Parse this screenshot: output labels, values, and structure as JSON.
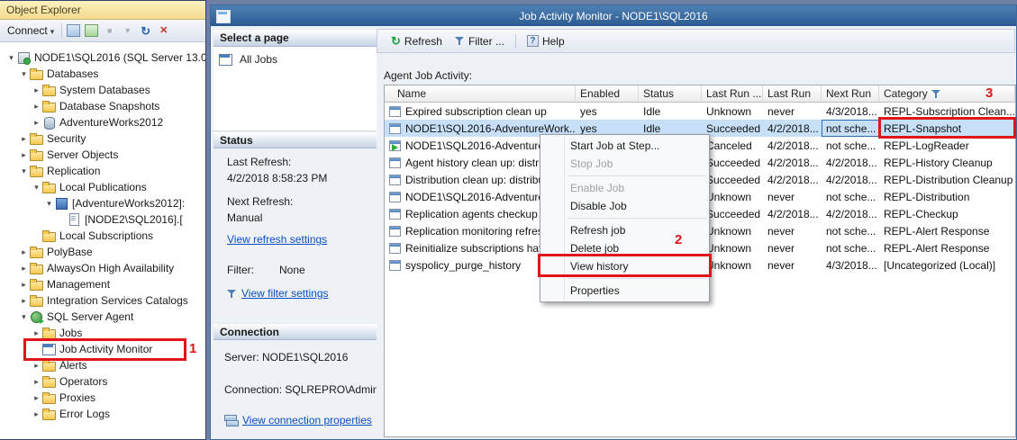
{
  "annotations": {
    "one": "1",
    "two": "2",
    "three": "3"
  },
  "object_explorer": {
    "title": "Object Explorer",
    "toolbar": {
      "connect_label": "Connect"
    },
    "tree": [
      {
        "label": "NODE1\\SQL2016 (SQL Server 13.0.",
        "level": 0,
        "exp": "-",
        "icon": "server"
      },
      {
        "label": "Databases",
        "level": 1,
        "exp": "-",
        "icon": "folder"
      },
      {
        "label": "System Databases",
        "level": 2,
        "exp": "+",
        "icon": "folder"
      },
      {
        "label": "Database Snapshots",
        "level": 2,
        "exp": "+",
        "icon": "folder"
      },
      {
        "label": "AdventureWorks2012",
        "level": 2,
        "exp": "+",
        "icon": "db"
      },
      {
        "label": "Security",
        "level": 1,
        "exp": "+",
        "icon": "folder"
      },
      {
        "label": "Server Objects",
        "level": 1,
        "exp": "+",
        "icon": "folder"
      },
      {
        "label": "Replication",
        "level": 1,
        "exp": "-",
        "icon": "folder"
      },
      {
        "label": "Local Publications",
        "level": 2,
        "exp": "-",
        "icon": "folder"
      },
      {
        "label": "[AdventureWorks2012]:",
        "level": 3,
        "exp": "-",
        "icon": "pub"
      },
      {
        "label": "[NODE2\\SQL2016].[",
        "level": 4,
        "exp": "",
        "icon": "sub"
      },
      {
        "label": "Local Subscriptions",
        "level": 2,
        "exp": "",
        "icon": "folder"
      },
      {
        "label": "PolyBase",
        "level": 1,
        "exp": "+",
        "icon": "folder"
      },
      {
        "label": "AlwaysOn High Availability",
        "level": 1,
        "exp": "+",
        "icon": "folder"
      },
      {
        "label": "Management",
        "level": 1,
        "exp": "+",
        "icon": "folder"
      },
      {
        "label": "Integration Services Catalogs",
        "level": 1,
        "exp": "+",
        "icon": "folder"
      },
      {
        "label": "SQL Server Agent",
        "level": 1,
        "exp": "-",
        "icon": "agent"
      },
      {
        "label": "Jobs",
        "level": 2,
        "exp": "+",
        "icon": "folder"
      },
      {
        "label": "Job Activity Monitor",
        "level": 2,
        "exp": "",
        "icon": "jam"
      },
      {
        "label": "Alerts",
        "level": 2,
        "exp": "+",
        "icon": "folder"
      },
      {
        "label": "Operators",
        "level": 2,
        "exp": "+",
        "icon": "folder"
      },
      {
        "label": "Proxies",
        "level": 2,
        "exp": "+",
        "icon": "folder"
      },
      {
        "label": "Error Logs",
        "level": 2,
        "exp": "+",
        "icon": "folder"
      }
    ]
  },
  "jam": {
    "title": "Job Activity Monitor - NODE1\\SQL2016",
    "select_page": {
      "header": "Select a page",
      "items": [
        {
          "label": "All Jobs"
        }
      ]
    },
    "status": {
      "header": "Status",
      "last_refresh_label": "Last Refresh:",
      "last_refresh_value": "4/2/2018 8:58:23 PM",
      "next_refresh_label": "Next Refresh:",
      "next_refresh_value": "Manual",
      "refresh_link": "View refresh settings",
      "filter_label": "Filter:",
      "filter_value": "None",
      "filter_link": "View filter settings"
    },
    "connection": {
      "header": "Connection",
      "server_text": "Server: NODE1\\SQL2016",
      "connection_text": "Connection: SQLREPRO\\Administra",
      "link": "View connection properties"
    },
    "toolbar": {
      "refresh": "Refresh",
      "filter": "Filter ...",
      "help": "Help"
    },
    "grid_caption": "Agent Job Activity:",
    "grid": {
      "columns": [
        "Name",
        "Enabled",
        "Status",
        "Last Run ...",
        "Last Run",
        "Next Run",
        "Category"
      ],
      "filtered_column": "Category",
      "selected_row": 1,
      "running_row": 2,
      "focus_cell": {
        "row": 1,
        "col": 5
      },
      "rows": [
        [
          "Expired subscription clean up",
          "yes",
          "Idle",
          "Unknown",
          "never",
          "4/3/2018...",
          "REPL-Subscription Clean..."
        ],
        [
          "NODE1\\SQL2016-AdventureWork...",
          "yes",
          "Idle",
          "Succeeded",
          "4/2/2018...",
          "not sche...",
          "REPL-Snapshot"
        ],
        [
          "NODE1\\SQL2016-AdventureW",
          "",
          "",
          "Canceled",
          "4/2/2018...",
          "not sche...",
          "REPL-LogReader"
        ],
        [
          "Agent history clean up: distributi",
          "",
          "",
          "Succeeded",
          "4/2/2018...",
          "4/2/2018...",
          "REPL-History Cleanup"
        ],
        [
          "Distribution clean up: distribution",
          "",
          "",
          "Succeeded",
          "4/2/2018...",
          "4/2/2018...",
          "REPL-Distribution Cleanup"
        ],
        [
          "NODE1\\SQL2016-AdventureW",
          "",
          "",
          "Unknown",
          "never",
          "not sche...",
          "REPL-Distribution"
        ],
        [
          "Replication agents checkup",
          "",
          "",
          "Succeeded",
          "4/2/2018...",
          "4/2/2018...",
          "REPL-Checkup"
        ],
        [
          "Replication monitoring refresher",
          "",
          "",
          "Unknown",
          "never",
          "not sche...",
          "REPL-Alert Response"
        ],
        [
          "Reinitialize subscriptions having",
          "",
          "",
          "Unknown",
          "never",
          "not sche...",
          "REPL-Alert Response"
        ],
        [
          "syspolicy_purge_history",
          "",
          "",
          "Unknown",
          "never",
          "4/3/2018...",
          "[Uncategorized (Local)]"
        ]
      ]
    },
    "context_menu": {
      "items": [
        {
          "label": "Start Job at Step...",
          "enabled": true
        },
        {
          "label": "Stop Job",
          "enabled": false
        },
        {
          "sep": true
        },
        {
          "label": "Enable Job",
          "enabled": false
        },
        {
          "label": "Disable Job",
          "enabled": true
        },
        {
          "sep": true
        },
        {
          "label": "Refresh job",
          "enabled": true
        },
        {
          "label": "Delete job",
          "enabled": true
        },
        {
          "label": "View history",
          "enabled": true,
          "highlighted": true
        },
        {
          "sep": true
        },
        {
          "label": "Properties",
          "enabled": true
        }
      ]
    }
  }
}
